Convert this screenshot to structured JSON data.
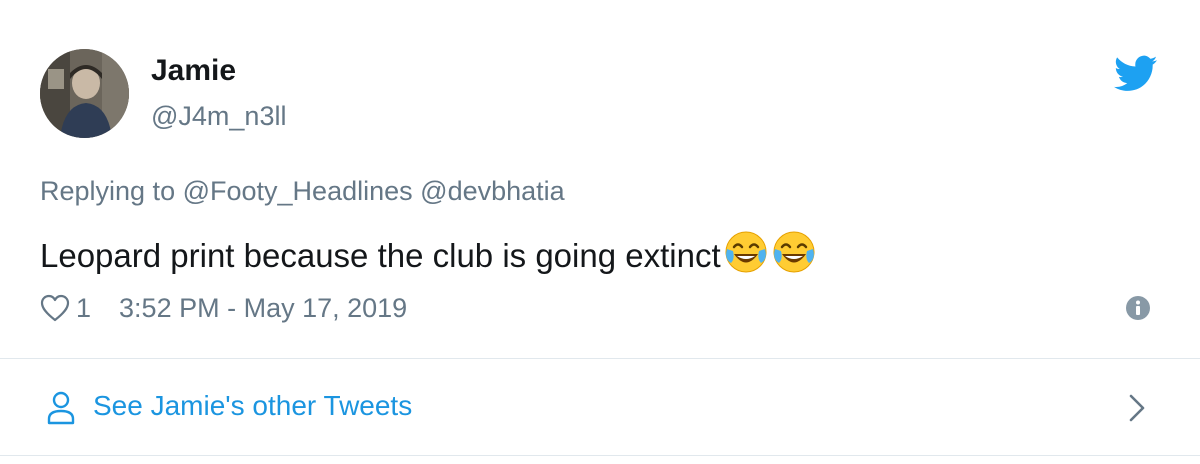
{
  "author": {
    "name": "Jamie",
    "handle": "@J4m_n3ll"
  },
  "reply": {
    "prefix": "Replying to",
    "mentions": [
      "@Footy_Headlines",
      "@devbhatia"
    ]
  },
  "tweet": {
    "text": "Leopard print because the club is going extinct",
    "emojis": [
      "face-with-tears-of-joy",
      "face-with-tears-of-joy"
    ]
  },
  "meta": {
    "like_count": "1",
    "timestamp": "3:52 PM - May 17, 2019"
  },
  "footer": {
    "other_tweets_label": "See Jamie's other Tweets"
  },
  "colors": {
    "text": "#14171a",
    "secondary": "#657786",
    "accent": "#1b95e0",
    "twitter_blue": "#1da1f2",
    "divider": "#e1e8ed"
  },
  "icons": {
    "brand": "twitter-bird-icon",
    "like": "heart-icon",
    "info": "info-icon",
    "profile": "person-icon",
    "chevron": "chevron-right-icon"
  }
}
